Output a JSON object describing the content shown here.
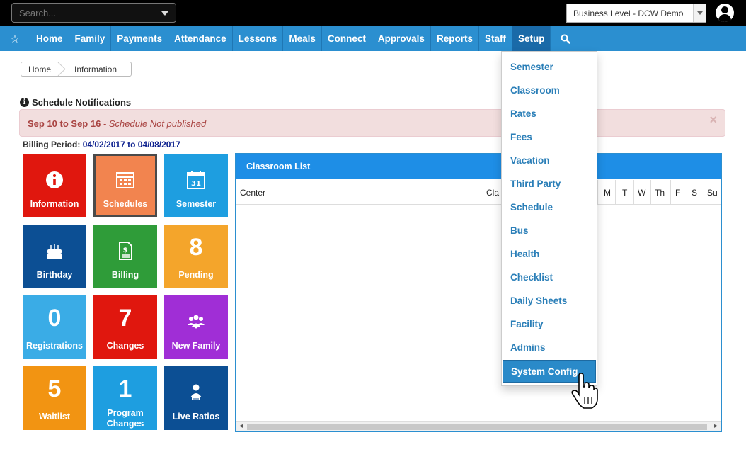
{
  "topbar": {
    "search_placeholder": "Search...",
    "business_select": "Business Level - DCW Demo",
    "user_icon": "user-circle-icon"
  },
  "nav": {
    "favorites_icon": "star-icon",
    "items": [
      "Home",
      "Family",
      "Payments",
      "Attendance",
      "Lessons",
      "Meals",
      "Connect",
      "Approvals",
      "Reports",
      "Staff",
      "Setup"
    ],
    "active": "Setup",
    "search_icon": "search-icon",
    "bar_color": "#2b8fd0"
  },
  "breadcrumb": {
    "items": [
      "Home",
      "Information"
    ]
  },
  "notifications": {
    "title": "Schedule Notifications",
    "alert_range": "Sep 10 to Sep 16",
    "alert_sep": " - ",
    "alert_message": "Schedule Not published",
    "close": "×"
  },
  "billing": {
    "label": "Billing Period:",
    "dates": "04/02/2017 to 04/08/2017"
  },
  "tiles": [
    {
      "label": "Information",
      "icon": "info-icon",
      "color": "#e0170e"
    },
    {
      "label": "Schedules",
      "icon": "calendar-grid-icon",
      "color": "#f2844f",
      "selected": true
    },
    {
      "label": "Semester",
      "icon": "calendar-31-icon",
      "color": "#1e9ee0"
    },
    {
      "label": "Birthday",
      "icon": "birthday-cake-icon",
      "color": "#0c4f94"
    },
    {
      "label": "Billing",
      "icon": "invoice-icon",
      "color": "#2f9c39"
    },
    {
      "label": "Pending",
      "value": "8",
      "color": "#f4a52b"
    },
    {
      "label": "Registrations",
      "value": "0",
      "color": "#3aace6"
    },
    {
      "label": "Changes",
      "value": "7",
      "color": "#e0170e"
    },
    {
      "label": "New Family",
      "icon": "family-group-icon",
      "color": "#a02ed6"
    },
    {
      "label": "Waitlist",
      "value": "5",
      "color": "#f29412"
    },
    {
      "label": "Program Changes",
      "value": "1",
      "color": "#1e9ee0"
    },
    {
      "label": "Live Ratios",
      "icon": "teacher-icon",
      "color": "#0c4f94"
    }
  ],
  "classroom_list": {
    "title": "Classroom List",
    "columns": [
      "Center",
      "Cla",
      "M",
      "T",
      "W",
      "Th",
      "F",
      "S",
      "Su"
    ]
  },
  "setup_menu": {
    "items": [
      "Semester",
      "Classroom",
      "Rates",
      "Fees",
      "Vacation",
      "Third Party",
      "Schedule",
      "Bus",
      "Health",
      "Checklist",
      "Daily Sheets",
      "Facility",
      "Admins",
      "System Config"
    ],
    "highlighted": "System Config"
  },
  "cursor_icon": "hand-pointer-icon"
}
